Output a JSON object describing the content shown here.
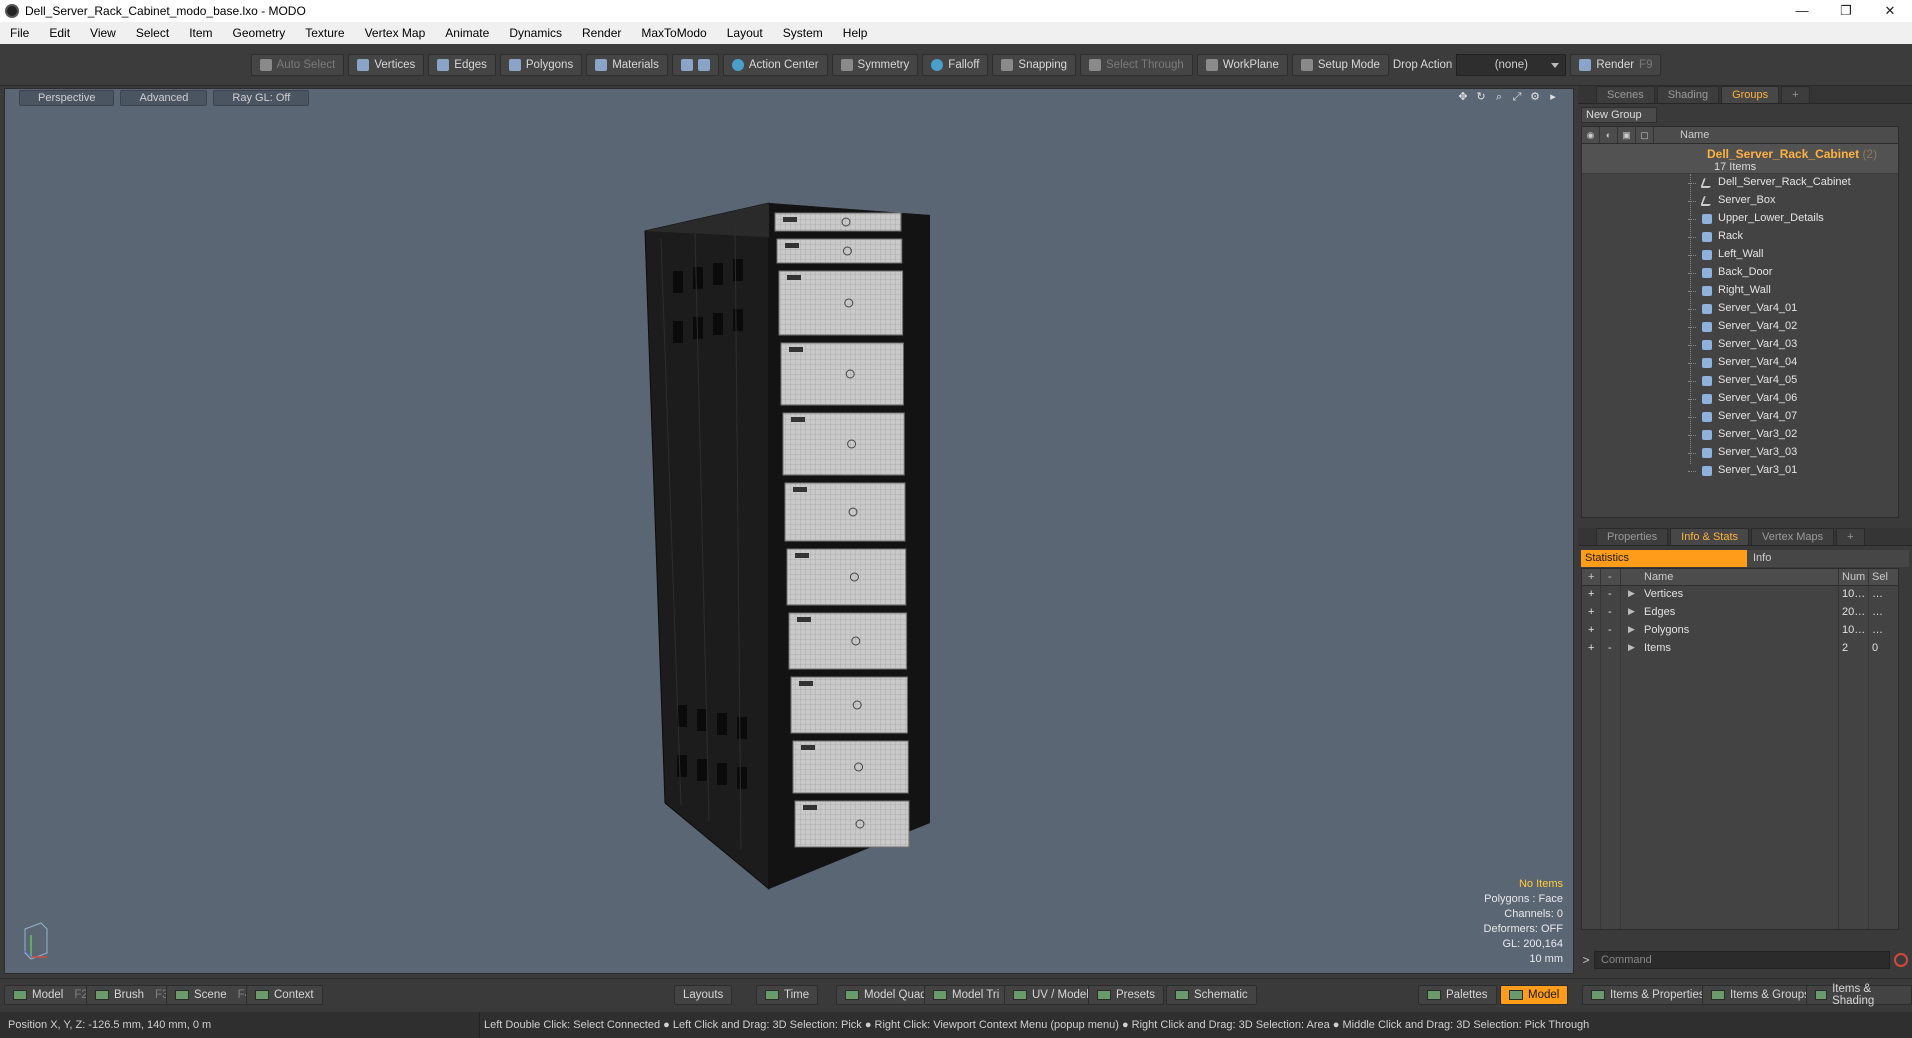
{
  "window": {
    "title": "Dell_Server_Rack_Cabinet_modo_base.lxo - MODO",
    "controls": [
      "—",
      "❐",
      "✕"
    ]
  },
  "menu": [
    "File",
    "Edit",
    "View",
    "Select",
    "Item",
    "Geometry",
    "Texture",
    "Vertex Map",
    "Animate",
    "Dynamics",
    "Render",
    "MaxToModo",
    "Layout",
    "System",
    "Help"
  ],
  "toolbar": {
    "auto_select": "Auto Select",
    "vertices": "Vertices",
    "edges": "Edges",
    "polygons": "Polygons",
    "materials": "Materials",
    "action_center": "Action Center",
    "symmetry": "Symmetry",
    "falloff": "Falloff",
    "snapping": "Snapping",
    "select_through": "Select Through",
    "workplane": "WorkPlane",
    "setup_mode": "Setup Mode",
    "drop_action_label": "Drop Action",
    "drop_action_value": "(none)",
    "render": "Render",
    "render_key": "F9"
  },
  "viewport": {
    "tabs": [
      "Perspective",
      "Advanced",
      "Ray GL: Off"
    ],
    "stats": {
      "no_items": "No Items",
      "polygons": "Polygons : Face",
      "channels": "Channels: 0",
      "deformers": "Deformers: OFF",
      "gl": "GL: 200,164",
      "scale": "10 mm"
    }
  },
  "groups_panel": {
    "tabs": [
      "Scenes",
      "Shading",
      "Groups"
    ],
    "active_tab": "Groups",
    "new_group": "New Group",
    "column_name": "Name",
    "root": {
      "name": "Dell_Server_Rack_Cabinet",
      "count": "(2)",
      "items": "17 Items"
    },
    "items": [
      {
        "name": "Dell_Server_Rack_Cabinet",
        "icon": "locator-icon"
      },
      {
        "name": "Server_Box",
        "icon": "locator-icon"
      },
      {
        "name": "Upper_Lower_Details",
        "icon": "mesh-icon"
      },
      {
        "name": "Rack",
        "icon": "mesh-icon"
      },
      {
        "name": "Left_Wall",
        "icon": "mesh-icon"
      },
      {
        "name": "Back_Door",
        "icon": "mesh-icon"
      },
      {
        "name": "Right_Wall",
        "icon": "mesh-icon"
      },
      {
        "name": "Server_Var4_01",
        "icon": "mesh-icon"
      },
      {
        "name": "Server_Var4_02",
        "icon": "mesh-icon"
      },
      {
        "name": "Server_Var4_03",
        "icon": "mesh-icon"
      },
      {
        "name": "Server_Var4_04",
        "icon": "mesh-icon"
      },
      {
        "name": "Server_Var4_05",
        "icon": "mesh-icon"
      },
      {
        "name": "Server_Var4_06",
        "icon": "mesh-icon"
      },
      {
        "name": "Server_Var4_07",
        "icon": "mesh-icon"
      },
      {
        "name": "Server_Var3_02",
        "icon": "mesh-icon"
      },
      {
        "name": "Server_Var3_03",
        "icon": "mesh-icon"
      },
      {
        "name": "Server_Var3_01",
        "icon": "mesh-icon"
      }
    ]
  },
  "stats_panel": {
    "tabs": [
      "Properties",
      "Info & Stats",
      "Vertex Maps"
    ],
    "active_tab": "Info & Stats",
    "sub_tabs": [
      "Statistics",
      "Info"
    ],
    "columns": {
      "name": "Name",
      "num": "Num",
      "sel": "Sel"
    },
    "rows": [
      {
        "name": "Vertices",
        "num": "10…",
        "sel": "…"
      },
      {
        "name": "Edges",
        "num": "20…",
        "sel": "…"
      },
      {
        "name": "Polygons",
        "num": "10…",
        "sel": "…"
      },
      {
        "name": "Items",
        "num": "2",
        "sel": "0"
      }
    ],
    "command_placeholder": "Command"
  },
  "bottom_bar": {
    "left": [
      {
        "label": "Model",
        "key": "F2"
      },
      {
        "label": "Brush",
        "key": "F3"
      },
      {
        "label": "Scene",
        "key": "F4"
      },
      {
        "label": "Context",
        "key": ""
      }
    ],
    "center": [
      "Layouts",
      "Time",
      "Model Quad",
      "Model Tri",
      "UV / Model",
      "Presets",
      "Schematic"
    ],
    "right": [
      "Palettes",
      "Model",
      "Items & Properties",
      "Items & Groups",
      "Items & Shading"
    ]
  },
  "status": {
    "position": "Position X, Y, Z:  -126.5 mm, 140 mm, 0 m",
    "hints": "Left Double Click: Select Connected ● Left Click and Drag: 3D Selection: Pick ● Right Click: Viewport Context Menu (popup menu) ● Right Click and Drag: 3D Selection: Area ● Middle Click and Drag: 3D Selection: Pick Through"
  },
  "colors": {
    "accent": "#ff9c1a",
    "viewport_bg": "#5b6675",
    "highlight_text": "#ffb23d"
  }
}
